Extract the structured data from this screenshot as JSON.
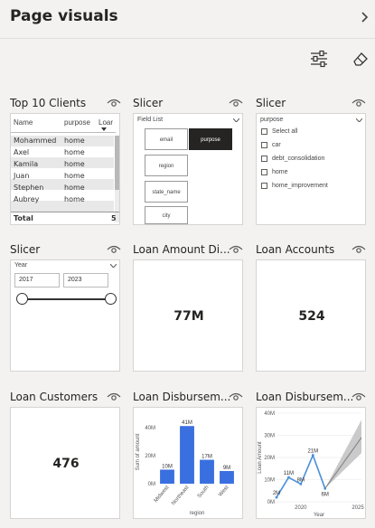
{
  "header": {
    "title": "Page visuals"
  },
  "cards": [
    {
      "title": "Top 10 Clients",
      "table": {
        "headers": [
          "Name",
          "purpose",
          "Loar"
        ],
        "rows": [
          [
            "Mohammed",
            "home"
          ],
          [
            "Axel",
            "home"
          ],
          [
            "Kamila",
            "home"
          ],
          [
            "Juan",
            "home"
          ],
          [
            "Stephen",
            "home"
          ],
          [
            "Aubrey",
            "home"
          ]
        ],
        "total_label": "Total",
        "total_value": "5"
      }
    },
    {
      "title": "Slicer",
      "field_list_label": "Field List",
      "tiles": [
        "email",
        "purpose",
        "region",
        "state_name",
        "city"
      ]
    },
    {
      "title": "Slicer",
      "field": "purpose",
      "options": [
        "Select all",
        "car",
        "debt_consolidation",
        "home",
        "home_improvement"
      ]
    },
    {
      "title": "Slicer",
      "field": "Year",
      "from": "2017",
      "to": "2023"
    },
    {
      "title": "Loan Amount Di...",
      "value": "77M"
    },
    {
      "title": "Loan Accounts",
      "value": "524"
    },
    {
      "title": "Loan Customers",
      "value": "476"
    },
    {
      "title": "Loan Disbursem..."
    },
    {
      "title": "Loan Disbursem..."
    }
  ],
  "chart_data": [
    {
      "type": "bar",
      "ylabel": "Sum of amount",
      "xlabel": "region",
      "categories": [
        "Midwest",
        "Northeast",
        "South",
        "West"
      ],
      "values": [
        10,
        41,
        17,
        9
      ],
      "data_labels": [
        "10M",
        "41M",
        "17M",
        "9M"
      ],
      "ytick_labels": [
        "0M",
        "20M",
        "40M"
      ],
      "ylim": [
        0,
        45
      ],
      "bar_color": "#3a6fe0"
    },
    {
      "type": "line",
      "ylabel": "Loan Amount",
      "xlabel": "Year",
      "x": [
        2018,
        2019,
        2020,
        2021,
        2022
      ],
      "values": [
        2,
        11,
        8,
        21,
        6
      ],
      "data_labels": [
        "2M",
        "11M",
        "8M",
        "21M",
        "6M"
      ],
      "ytick_labels": [
        "0M",
        "10M",
        "20M",
        "30M",
        "40M"
      ],
      "xtick_labels": [
        "2020",
        "2025"
      ],
      "ylim": [
        0,
        40
      ],
      "line_color": "#4a8fd9",
      "forecast_color": "#888888"
    }
  ]
}
